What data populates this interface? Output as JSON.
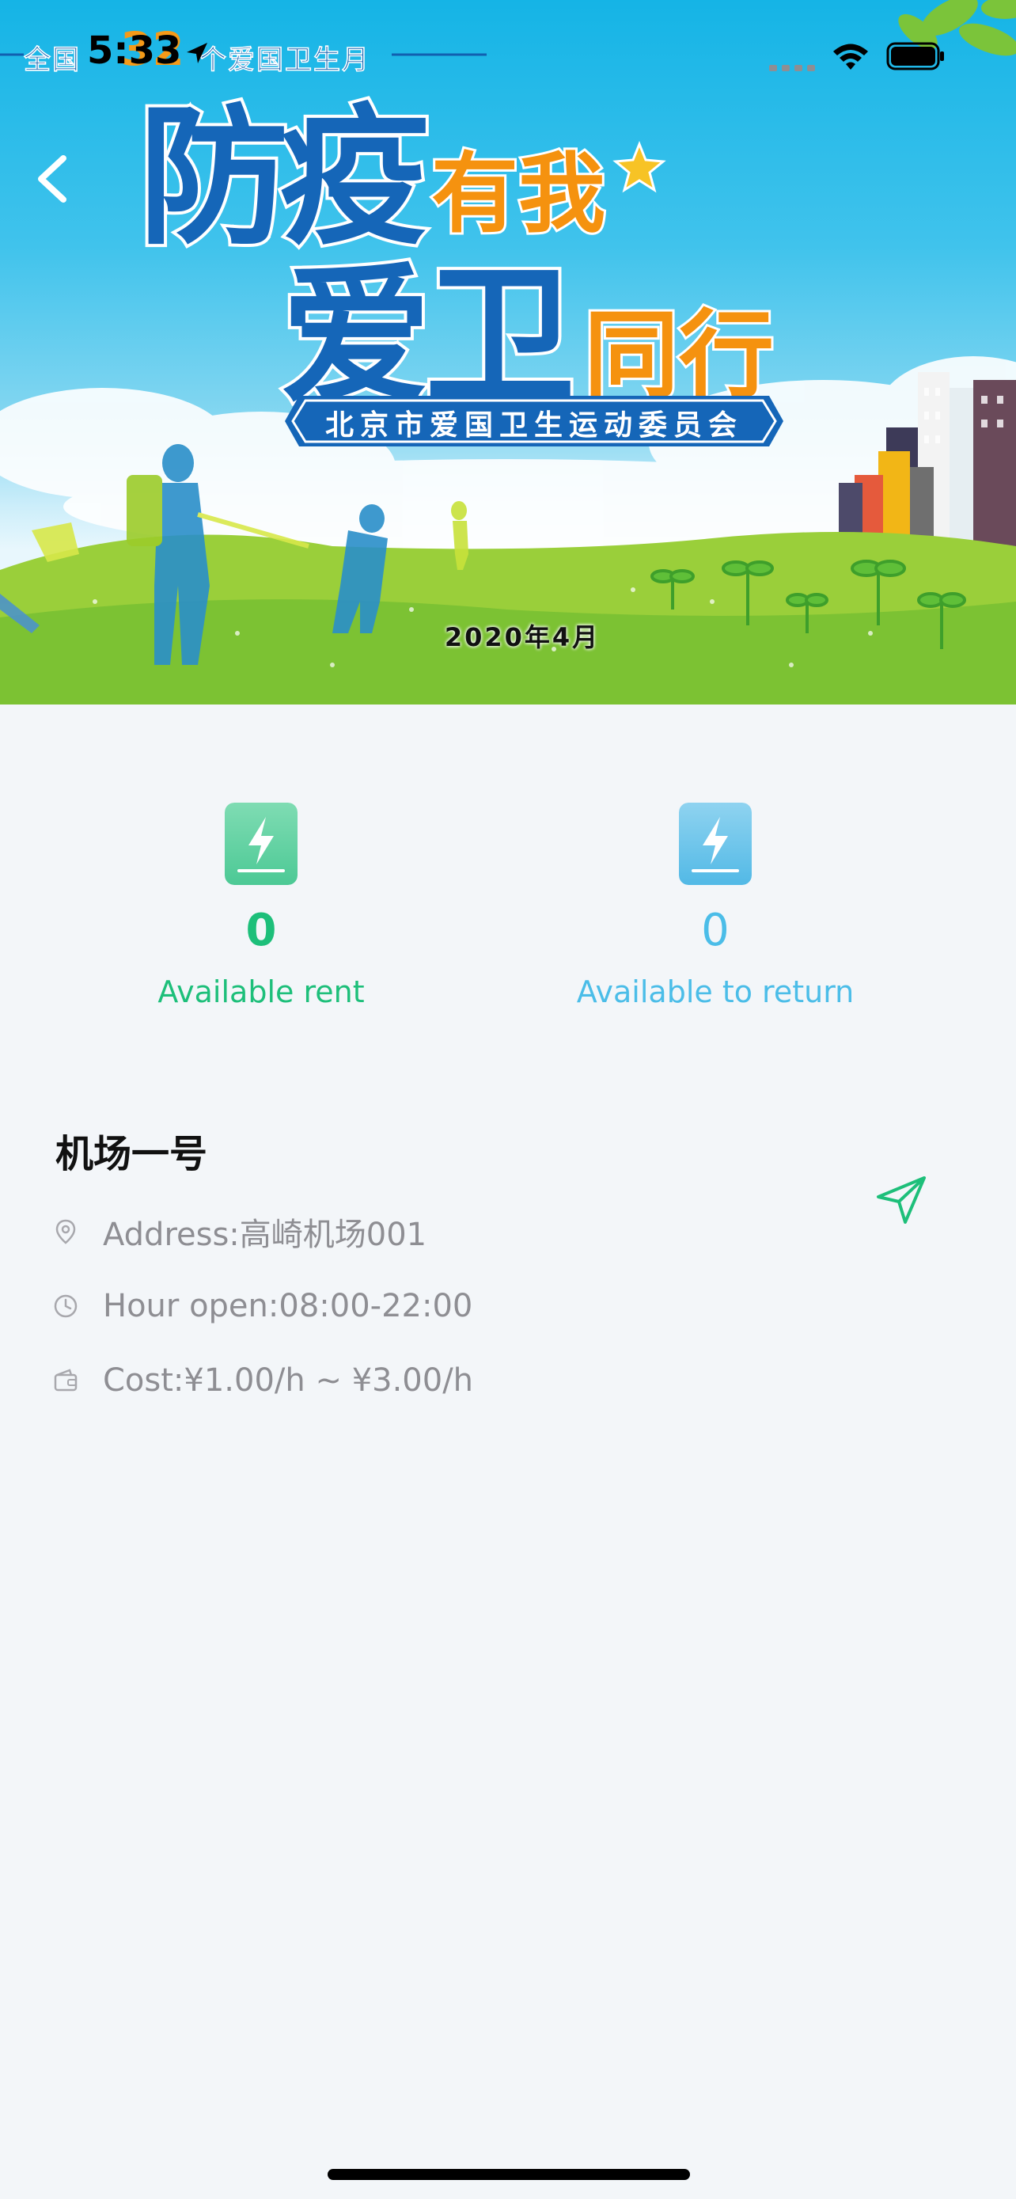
{
  "status_bar": {
    "time": "5:33",
    "banner_strip": "全国",
    "banner_strip_tail": "个爱国卫生月",
    "overlay_number": "32"
  },
  "hero": {
    "title_line1_a": "防疫",
    "title_line1_b": "有我",
    "title_line2_a": "爱卫",
    "title_line2_b": "同行",
    "ribbon": "北京市爱国卫生运动委员会",
    "date": "2020年4月"
  },
  "stats": {
    "rent": {
      "count": "0",
      "label": "Available rent",
      "color": "#1dbf7a"
    },
    "return": {
      "count": "0",
      "label": "Available to return",
      "color": "#4bbde8"
    }
  },
  "station": {
    "name": "机场一号",
    "address": "Address:高崎机场001",
    "hours": "Hour open:08:00-22:00",
    "cost": "Cost:¥1.00/h ~ ¥3.00/h"
  },
  "icons": {
    "back": "chevron-left-icon",
    "rent": "charge-bolt-icon",
    "return": "charge-bolt-icon",
    "navigate": "navigation-arrow-icon",
    "address": "location-pin-icon",
    "hours": "clock-icon",
    "cost": "wallet-icon"
  }
}
